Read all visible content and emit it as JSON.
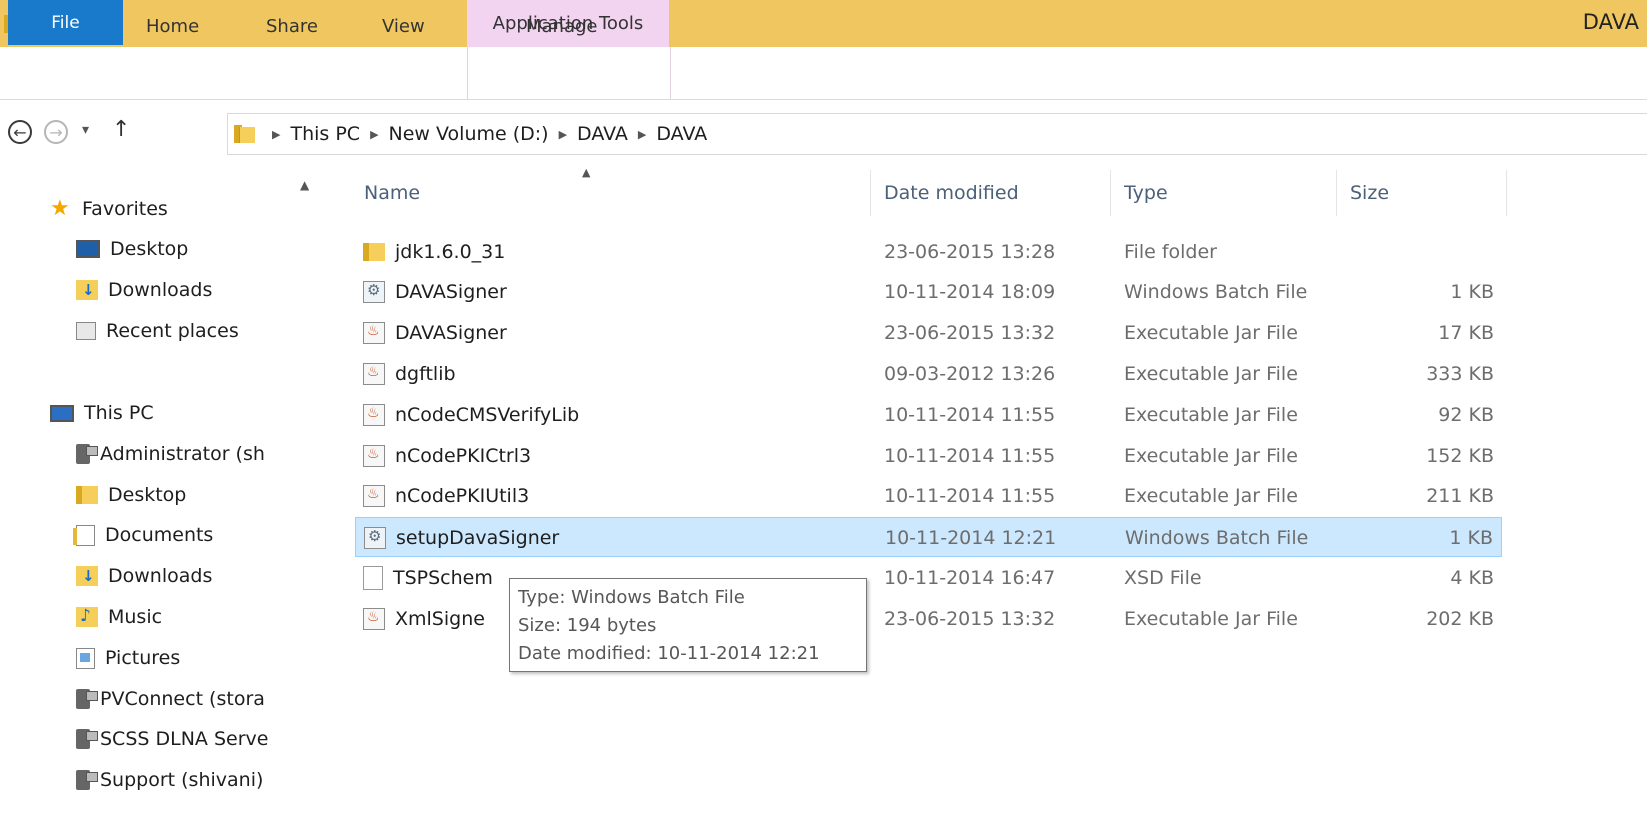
{
  "window": {
    "title": "DAVA",
    "context_tab_group": "Application Tools"
  },
  "ribbon": {
    "tabs": [
      "File",
      "Home",
      "Share",
      "View",
      "Manage"
    ]
  },
  "address_bar": {
    "crumbs": [
      "This PC",
      "New Volume (D:)",
      "DAVA",
      "DAVA"
    ]
  },
  "nav_pane": {
    "favorites_label": "Favorites",
    "favorites": [
      "Desktop",
      "Downloads",
      "Recent places"
    ],
    "this_pc_label": "This PC",
    "this_pc_items": [
      "Administrator (sh",
      "Desktop",
      "Documents",
      "Downloads",
      "Music",
      "Pictures",
      "PVConnect (stora",
      "SCSS DLNA Serve",
      "Support (shivani)"
    ]
  },
  "columns": {
    "name": "Name",
    "date": "Date modified",
    "type": "Type",
    "size": "Size"
  },
  "files": [
    {
      "name": "jdk1.6.0_31",
      "date": "23-06-2015 13:28",
      "type": "File folder",
      "size": "",
      "icon": "folder-icon"
    },
    {
      "name": "DAVASigner",
      "date": "10-11-2014 18:09",
      "type": "Windows Batch File",
      "size": "1 KB",
      "icon": "batch-file-icon"
    },
    {
      "name": "DAVASigner",
      "date": "23-06-2015 13:32",
      "type": "Executable Jar File",
      "size": "17 KB",
      "icon": "jar-file-icon"
    },
    {
      "name": "dgftlib",
      "date": "09-03-2012 13:26",
      "type": "Executable Jar File",
      "size": "333 KB",
      "icon": "jar-file-icon"
    },
    {
      "name": "nCodeCMSVerifyLib",
      "date": "10-11-2014 11:55",
      "type": "Executable Jar File",
      "size": "92 KB",
      "icon": "jar-file-icon"
    },
    {
      "name": "nCodePKICtrl3",
      "date": "10-11-2014 11:55",
      "type": "Executable Jar File",
      "size": "152 KB",
      "icon": "jar-file-icon"
    },
    {
      "name": "nCodePKIUtil3",
      "date": "10-11-2014 11:55",
      "type": "Executable Jar File",
      "size": "211 KB",
      "icon": "jar-file-icon"
    },
    {
      "name": "setupDavaSigner",
      "date": "10-11-2014 12:21",
      "type": "Windows Batch File",
      "size": "1 KB",
      "icon": "batch-file-icon",
      "selected": true
    },
    {
      "name": "TSPSchem",
      "date": "10-11-2014 16:47",
      "type": "XSD File",
      "size": "4 KB",
      "icon": "xsd-file-icon"
    },
    {
      "name": "XmlSigne",
      "date": "23-06-2015 13:32",
      "type": "Executable Jar File",
      "size": "202 KB",
      "icon": "jar-file-icon"
    }
  ],
  "tooltip": {
    "line1": "Type: Windows Batch File",
    "line2": "Size: 194 bytes",
    "line3": "Date modified: 10-11-2014 12:21"
  }
}
